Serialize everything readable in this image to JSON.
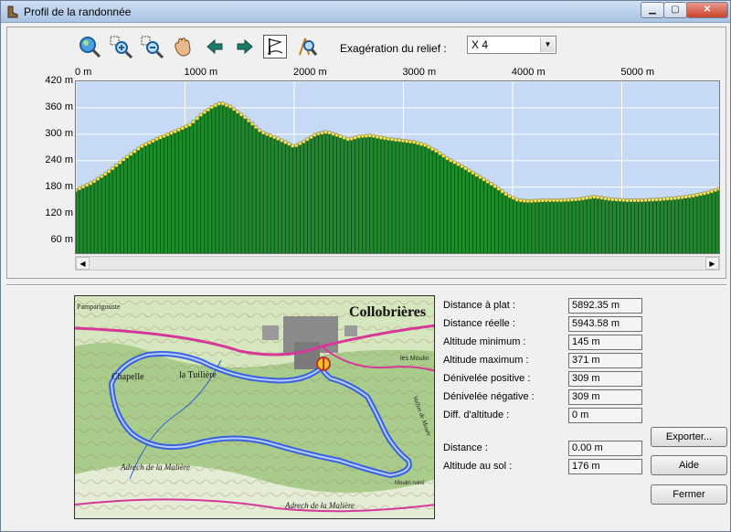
{
  "window": {
    "title": "Profil de la randonnée"
  },
  "toolbar": {
    "tools": [
      {
        "name": "zoom-fit-icon"
      },
      {
        "name": "zoom-in-icon"
      },
      {
        "name": "zoom-out-icon"
      },
      {
        "name": "pan-hand-icon"
      },
      {
        "name": "arrow-left-icon"
      },
      {
        "name": "arrow-right-icon"
      },
      {
        "name": "flag-icon"
      },
      {
        "name": "compass-zoom-icon"
      }
    ],
    "exaggeration_label": "Exagération du relief :",
    "exaggeration_value": "X 4"
  },
  "chart_data": {
    "type": "area",
    "x_tick_labels": [
      "0 m",
      "1000 m",
      "2000 m",
      "3000 m",
      "4000 m",
      "5000 m"
    ],
    "x_ticks": [
      0,
      1000,
      2000,
      3000,
      4000,
      5000
    ],
    "y_tick_labels": [
      "420 m",
      "360 m",
      "300 m",
      "240 m",
      "180 m",
      "120 m",
      "60 m"
    ],
    "y_ticks": [
      420,
      360,
      300,
      240,
      180,
      120,
      60
    ],
    "xlim": [
      0,
      5892
    ],
    "ylim": [
      30,
      420
    ],
    "x": [
      0,
      150,
      300,
      450,
      600,
      750,
      900,
      1050,
      1150,
      1250,
      1330,
      1420,
      1550,
      1700,
      1850,
      2000,
      2100,
      2200,
      2300,
      2400,
      2500,
      2600,
      2700,
      2800,
      2900,
      3000,
      3100,
      3200,
      3300,
      3400,
      3550,
      3700,
      3850,
      3950,
      4050,
      4150,
      4300,
      4450,
      4600,
      4750,
      4900,
      5050,
      5200,
      5350,
      5500,
      5650,
      5800,
      5892
    ],
    "y": [
      173,
      190,
      215,
      245,
      272,
      290,
      305,
      322,
      345,
      362,
      371,
      362,
      338,
      305,
      290,
      272,
      285,
      300,
      305,
      297,
      288,
      295,
      297,
      292,
      288,
      285,
      282,
      275,
      262,
      245,
      225,
      203,
      180,
      162,
      150,
      148,
      150,
      150,
      152,
      158,
      152,
      150,
      150,
      152,
      155,
      160,
      168,
      176
    ],
    "grid": true,
    "fill_color": "#1f8a2c",
    "point_color": "#f3e65a",
    "background_color": "#c6d9f5"
  },
  "map": {
    "town": "Collobrières",
    "place_labels": [
      "Pamparigouste",
      "Chapelle",
      "la Tuilière",
      "Adrech de la Malière",
      "Adrech de la Malière",
      "Moulin ruiné",
      "les Moulin",
      "Vallon de Moure"
    ],
    "route_color": "#2b56e6"
  },
  "stats": [
    {
      "label": "Distance à plat :",
      "value": "5892.35 m"
    },
    {
      "label": "Distance réelle :",
      "value": "5943.58 m"
    },
    {
      "label": "Altitude minimum :",
      "value": "145 m"
    },
    {
      "label": "Altitude maximum :",
      "value": "371 m"
    },
    {
      "label": "Dénivelée positive :",
      "value": "309 m"
    },
    {
      "label": "Dénivelée négative :",
      "value": "309 m"
    },
    {
      "label": "Diff. d'altitude :",
      "value": "0 m"
    }
  ],
  "cursor_stats": [
    {
      "label": "Distance :",
      "value": "0.00 m"
    },
    {
      "label": "Altitude au sol :",
      "value": "176 m"
    }
  ],
  "buttons": {
    "export": "Exporter...",
    "help": "Aide",
    "close": "Fermer"
  },
  "colors": {
    "accent": "#1f8a2c",
    "route": "#2b56e6"
  }
}
